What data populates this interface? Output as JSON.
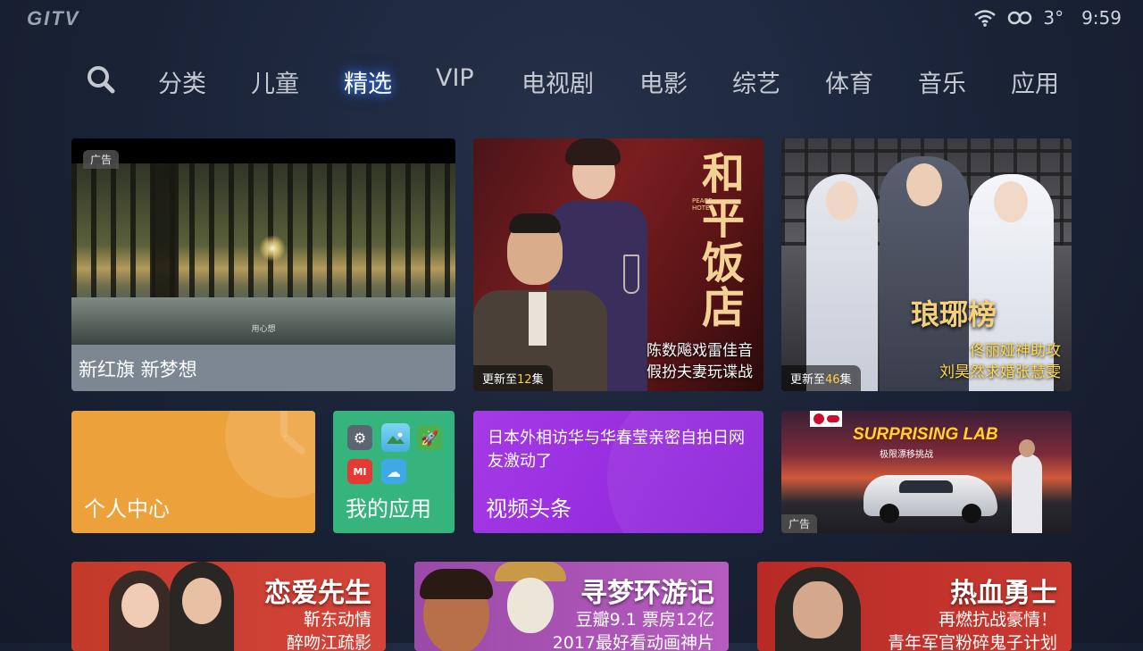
{
  "status_bar": {
    "logo": "GITV",
    "temperature": "3°",
    "time": "9:59"
  },
  "nav": {
    "items": [
      "分类",
      "儿童",
      "精选",
      "VIP",
      "电视剧",
      "电影",
      "综艺",
      "体育",
      "音乐",
      "应用"
    ],
    "active": "精选"
  },
  "tiles": {
    "ad_banner": {
      "ad_tag": "广告",
      "subtitle": "用心想",
      "title": "新红旗 新梦想"
    },
    "peace_hotel": {
      "title": "和平饭店",
      "title_en": "PEACE HOTEL",
      "caption_line1": "陈数飚戏雷佳音",
      "caption_line2": "假扮夫妻玩谍战",
      "update_prefix": "更新至",
      "update_count": "12",
      "update_suffix": "集"
    },
    "langya": {
      "title": "琅琊榜",
      "caption_line1": "佟丽娅神助攻",
      "caption_line2": "刘昊然求婚张慧雯",
      "update_prefix": "更新至",
      "update_count": "46",
      "update_suffix": "集"
    },
    "personal": {
      "label": "个人中心"
    },
    "my_apps": {
      "label": "我的应用",
      "mi_icon": "MI"
    },
    "news": {
      "headline": "日本外相访华与华春莹亲密自拍日网友激动了",
      "label": "视频头条"
    },
    "surprising": {
      "title": "SURPRISING LAB",
      "subtitle": "极限漂移挑战",
      "ad_tag": "广告"
    },
    "love": {
      "title": "恋爱先生",
      "line1": "靳东动情",
      "line2": "醉吻江疏影"
    },
    "coco": {
      "title": "寻梦环游记",
      "line1": "豆瓣9.1 票房12亿",
      "line2": "2017最好看动画神片"
    },
    "hero": {
      "title": "热血勇士",
      "line1": "再燃抗战豪情！",
      "line2": "青年军官粉碎鬼子计划"
    }
  },
  "colors": {
    "personal_bg": "#eda13b",
    "apps_bg": "#35b57d",
    "news_bg": "#9a2fe0",
    "ad_caption_bg": "#7d8794"
  }
}
